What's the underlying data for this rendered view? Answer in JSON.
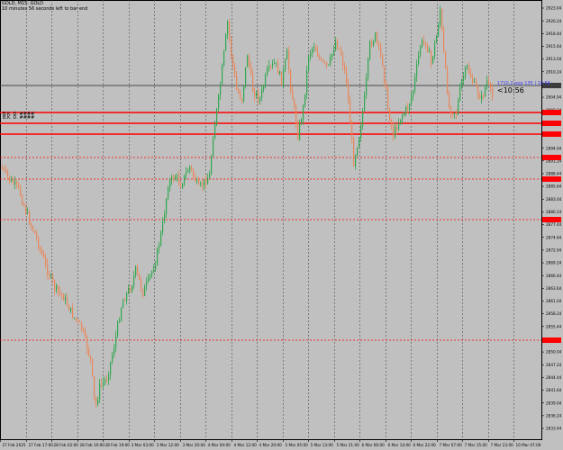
{
  "header": {
    "symbol_line": "GOLD, M15: GOLD",
    "timer_line": "10 minutes 56 seconds left to bar end"
  },
  "chart_overlay": {
    "line_label": "1710,2 ppp 135 | 10,56",
    "countdown": "<10:56",
    "box_labels": [
      "B.K. D. ####",
      "B.K. D. ####"
    ]
  },
  "price_labels": [
    "2923.04",
    "2920.24",
    "2918.44",
    "2915.64",
    "2913.04",
    "2910.24",
    "2907.84",
    "2904.94",
    "2902.24",
    "2899.44",
    "2896.64",
    "2894.04",
    "2891.24",
    "2888.44",
    "2885.64",
    "2883.04",
    "2880.24",
    "2877.44",
    "2874.64",
    "2872.04",
    "2869.24",
    "2866.44",
    "2863.64",
    "2861.04",
    "2858.24",
    "2855.44",
    "2852.64",
    "2850.04",
    "2847.24",
    "2844.44",
    "2841.64",
    "2839.04",
    "2836.24",
    "2833.44"
  ],
  "time_labels": [
    "27 Feb 2025",
    "27 Feb 17:00",
    "28 Feb 02:00",
    "28 Feb 10:00",
    "28 Feb 19:00",
    "3 Mar 03:00",
    "3 Mar 12:00",
    "3 Mar 20:00",
    "4 Mar 04:00",
    "4 Mar 12:00",
    "4 Mar 20:00",
    "5 Mar 05:00",
    "5 Mar 13:00",
    "5 Mar 21:00",
    "6 Mar 06:00",
    "6 Mar 14:00",
    "6 Mar 22:00",
    "7 Mar 07:00",
    "7 Mar 15:00",
    "7 Mar 23:00",
    "10 Mar 07:00"
  ],
  "colors": {
    "background": "#c0c0c0",
    "bull": "#2fa84f",
    "bear": "#e8875a",
    "level": "#ff0000",
    "ask": "#4a4a4a"
  }
}
